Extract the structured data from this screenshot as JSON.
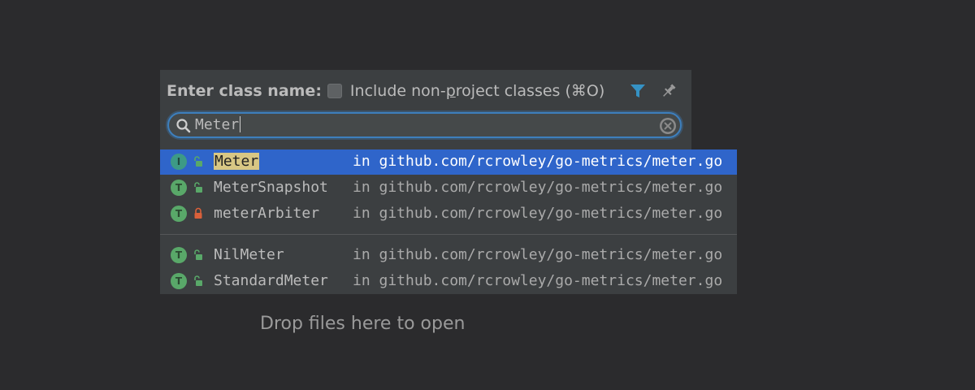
{
  "dialog": {
    "title": "Enter class name:",
    "include_label_pre": "Include non-",
    "include_label_underlined": "p",
    "include_label_post": "roject classes (⌘O)",
    "include_checked": false,
    "filter_icon": "filter-icon",
    "pin_icon": "pin-icon"
  },
  "search": {
    "value": "Meter",
    "icon": "search-icon",
    "clear_icon": "clear-icon"
  },
  "results": [
    {
      "kind": "I",
      "visibility": "public",
      "name": "Meter",
      "location": "in github.com/rcrowley/go-metrics/meter.go",
      "selected": true
    },
    {
      "kind": "T",
      "visibility": "public",
      "name": "MeterSnapshot",
      "location": "in github.com/rcrowley/go-metrics/meter.go",
      "selected": false
    },
    {
      "kind": "T",
      "visibility": "private",
      "name": "meterArbiter",
      "location": "in github.com/rcrowley/go-metrics/meter.go",
      "selected": false
    },
    {
      "kind": "T",
      "visibility": "public",
      "name": "NilMeter",
      "location": "in github.com/rcrowley/go-metrics/meter.go",
      "selected": false
    },
    {
      "kind": "T",
      "visibility": "public",
      "name": "StandardMeter",
      "location": "in github.com/rcrowley/go-metrics/meter.go",
      "selected": false
    }
  ],
  "drop_hint": "Drop files here to open",
  "colors": {
    "background": "#2b2b2d",
    "popup": "#3c3f41",
    "selection": "#2f65ca",
    "focus_ring": "#3d7fbd",
    "filter_icon": "#3592c4",
    "type_badge": "#59a869",
    "interface_badge": "#3d9a86",
    "match_highlight": "#d8c784",
    "lock_private": "#d9603a",
    "lock_public": "#59a869"
  }
}
